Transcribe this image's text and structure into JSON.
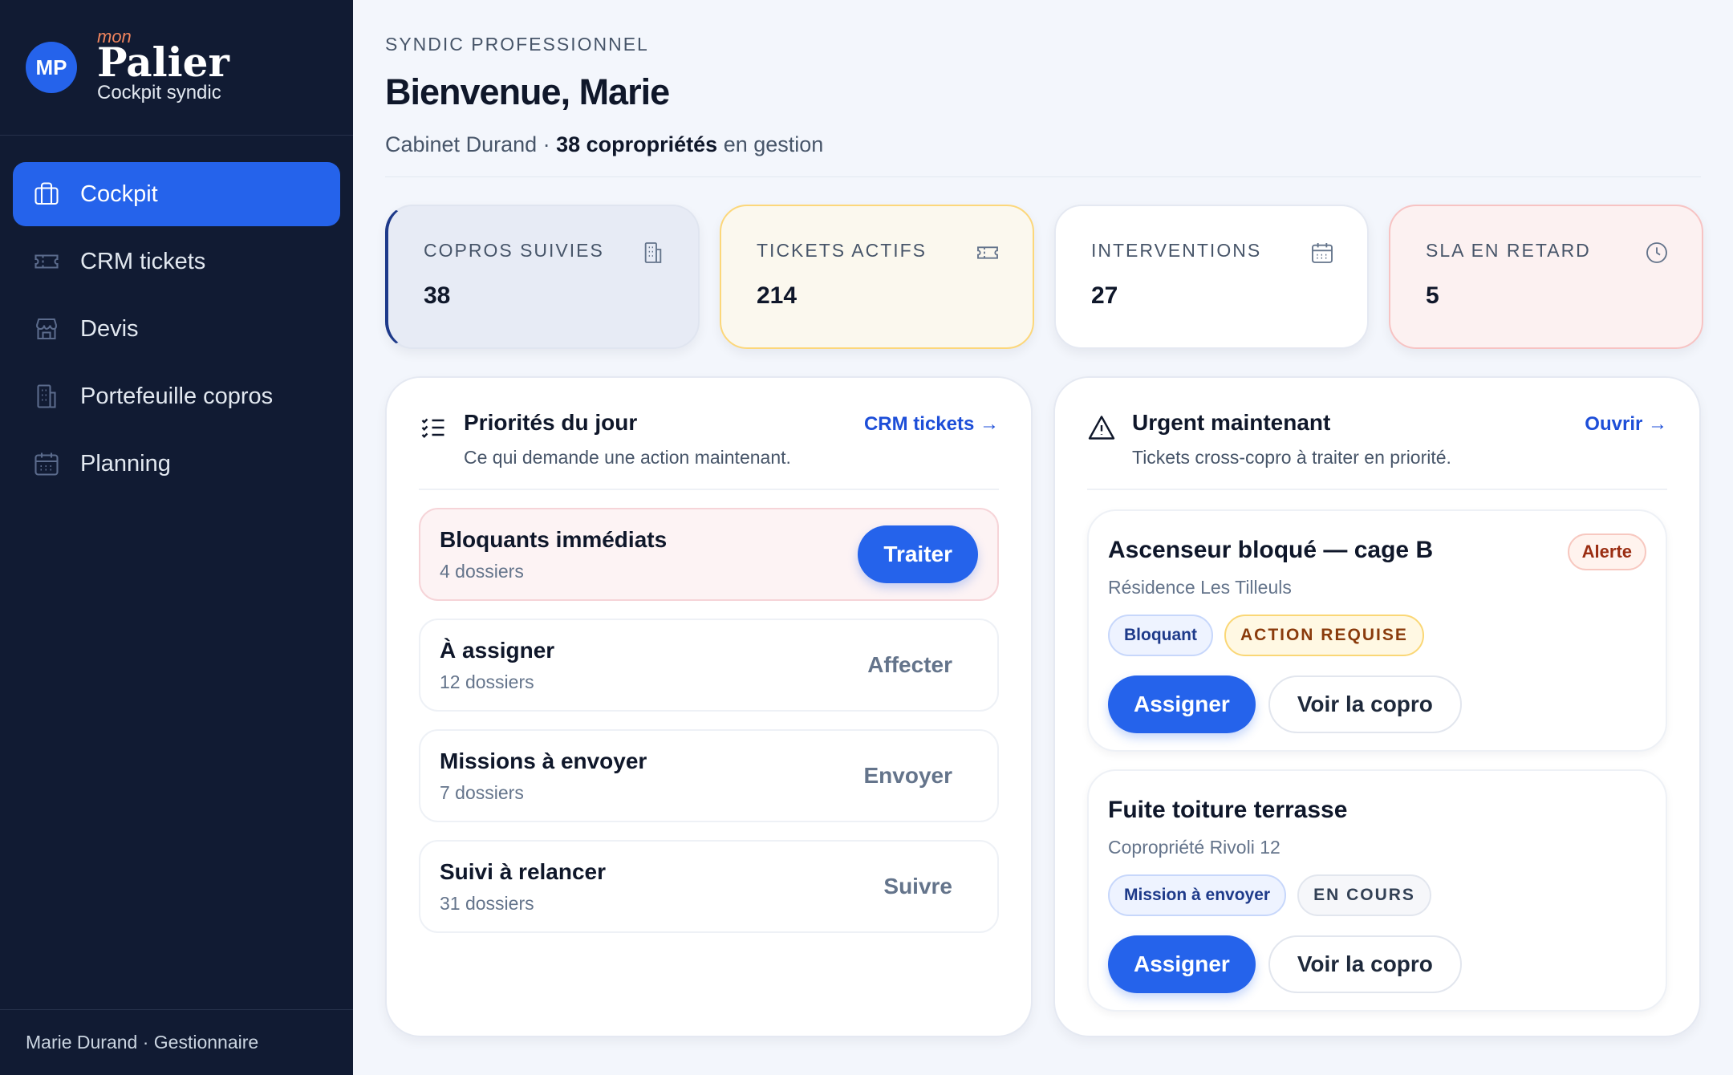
{
  "brand": {
    "initials": "MP",
    "prefix": "mon",
    "name": "Palier",
    "tagline": "Cockpit syndic"
  },
  "sidebar": {
    "items": [
      {
        "label": "Cockpit",
        "icon": "briefcase-icon",
        "active": true
      },
      {
        "label": "CRM tickets",
        "icon": "ticket-icon",
        "active": false
      },
      {
        "label": "Devis",
        "icon": "store-icon",
        "active": false
      },
      {
        "label": "Portefeuille copros",
        "icon": "building-icon",
        "active": false
      },
      {
        "label": "Planning",
        "icon": "calendar-icon",
        "active": false
      }
    ],
    "footer": "Marie Durand · Gestionnaire"
  },
  "header": {
    "eyebrow": "SYNDIC PROFESSIONNEL",
    "title": "Bienvenue, Marie",
    "subtitle_prefix": "Cabinet Durand · ",
    "subtitle_bold": "38 copropriétés",
    "subtitle_suffix": " en gestion"
  },
  "stats": [
    {
      "label": "COPROS SUIVIES",
      "value": "38",
      "icon": "building-icon"
    },
    {
      "label": "TICKETS ACTIFS",
      "value": "214",
      "icon": "ticket-icon"
    },
    {
      "label": "INTERVENTIONS",
      "value": "27",
      "icon": "calendar-icon"
    },
    {
      "label": "SLA EN RETARD",
      "value": "5",
      "icon": "clock-icon"
    }
  ],
  "priorities": {
    "title": "Priorités du jour",
    "subtitle": "Ce qui demande une action maintenant.",
    "link": "CRM tickets →",
    "items": [
      {
        "title": "Bloquants immédiats",
        "count": "4 dossiers",
        "action": "Traiter"
      },
      {
        "title": "À assigner",
        "count": "12 dossiers",
        "action": "Affecter"
      },
      {
        "title": "Missions à envoyer",
        "count": "7 dossiers",
        "action": "Envoyer"
      },
      {
        "title": "Suivi à relancer",
        "count": "31 dossiers",
        "action": "Suivre"
      }
    ]
  },
  "urgent": {
    "title": "Urgent maintenant",
    "subtitle": "Tickets cross-copro à traiter en priorité.",
    "link": "Ouvrir →",
    "tickets": [
      {
        "title": "Ascenseur bloqué — cage B",
        "residence": "Résidence Les Tilleuls",
        "badge": "Alerte",
        "tag1": "Bloquant",
        "tag2": "ACTION REQUISE",
        "primary": "Assigner",
        "secondary": "Voir la copro"
      },
      {
        "title": "Fuite toiture terrasse",
        "residence": "Copropriété Rivoli 12",
        "tag1": "Mission à envoyer",
        "tag2": "EN COURS",
        "primary": "Assigner",
        "secondary": "Voir la copro"
      }
    ]
  },
  "colors": {
    "accent": "#2563eb",
    "sidebar": "#111b33",
    "background": "#f3f6fc"
  }
}
